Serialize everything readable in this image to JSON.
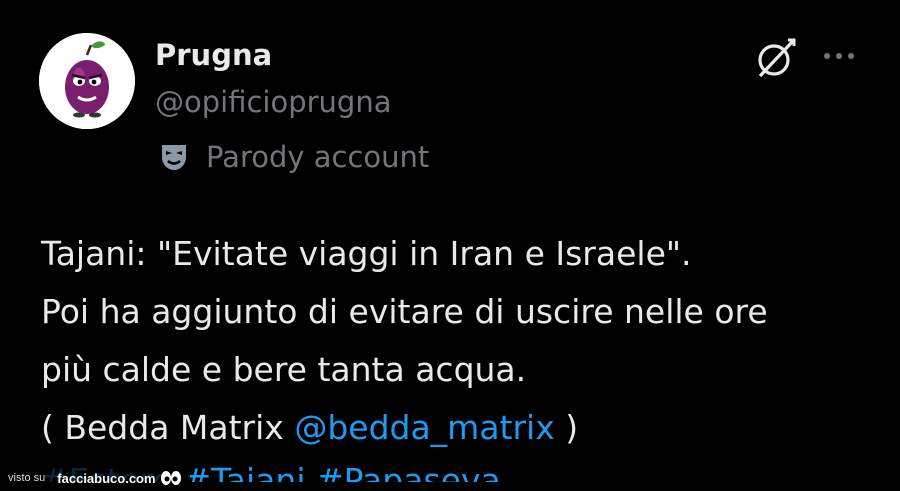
{
  "author": {
    "display_name": "Prugna",
    "handle": "@opificioprugna",
    "parody_label": "Parody account",
    "avatar_icon": "plum-mascot-icon"
  },
  "header_actions": {
    "grok_icon": "grok-icon",
    "more_icon": "more-options-icon"
  },
  "tweet": {
    "lines": [
      "Tajani: \"Evitate viaggi in Iran e Israele\".",
      "Poi ha aggiunto di evitare di uscire nelle ore",
      "più calde e bere tanta acqua."
    ],
    "credit_prefix": "( Bedda Matrix ",
    "mention": "@bedda_matrix",
    "credit_suffix": " )",
    "hashtags_partial": "#Estero #Tajani #Papaseva..."
  },
  "watermark": {
    "prefix": "visto su",
    "brand": "facciabuco.com"
  },
  "colors": {
    "background": "#000000",
    "text_primary": "#e7e9ea",
    "text_secondary": "#71767b",
    "link": "#1d9bf0"
  }
}
